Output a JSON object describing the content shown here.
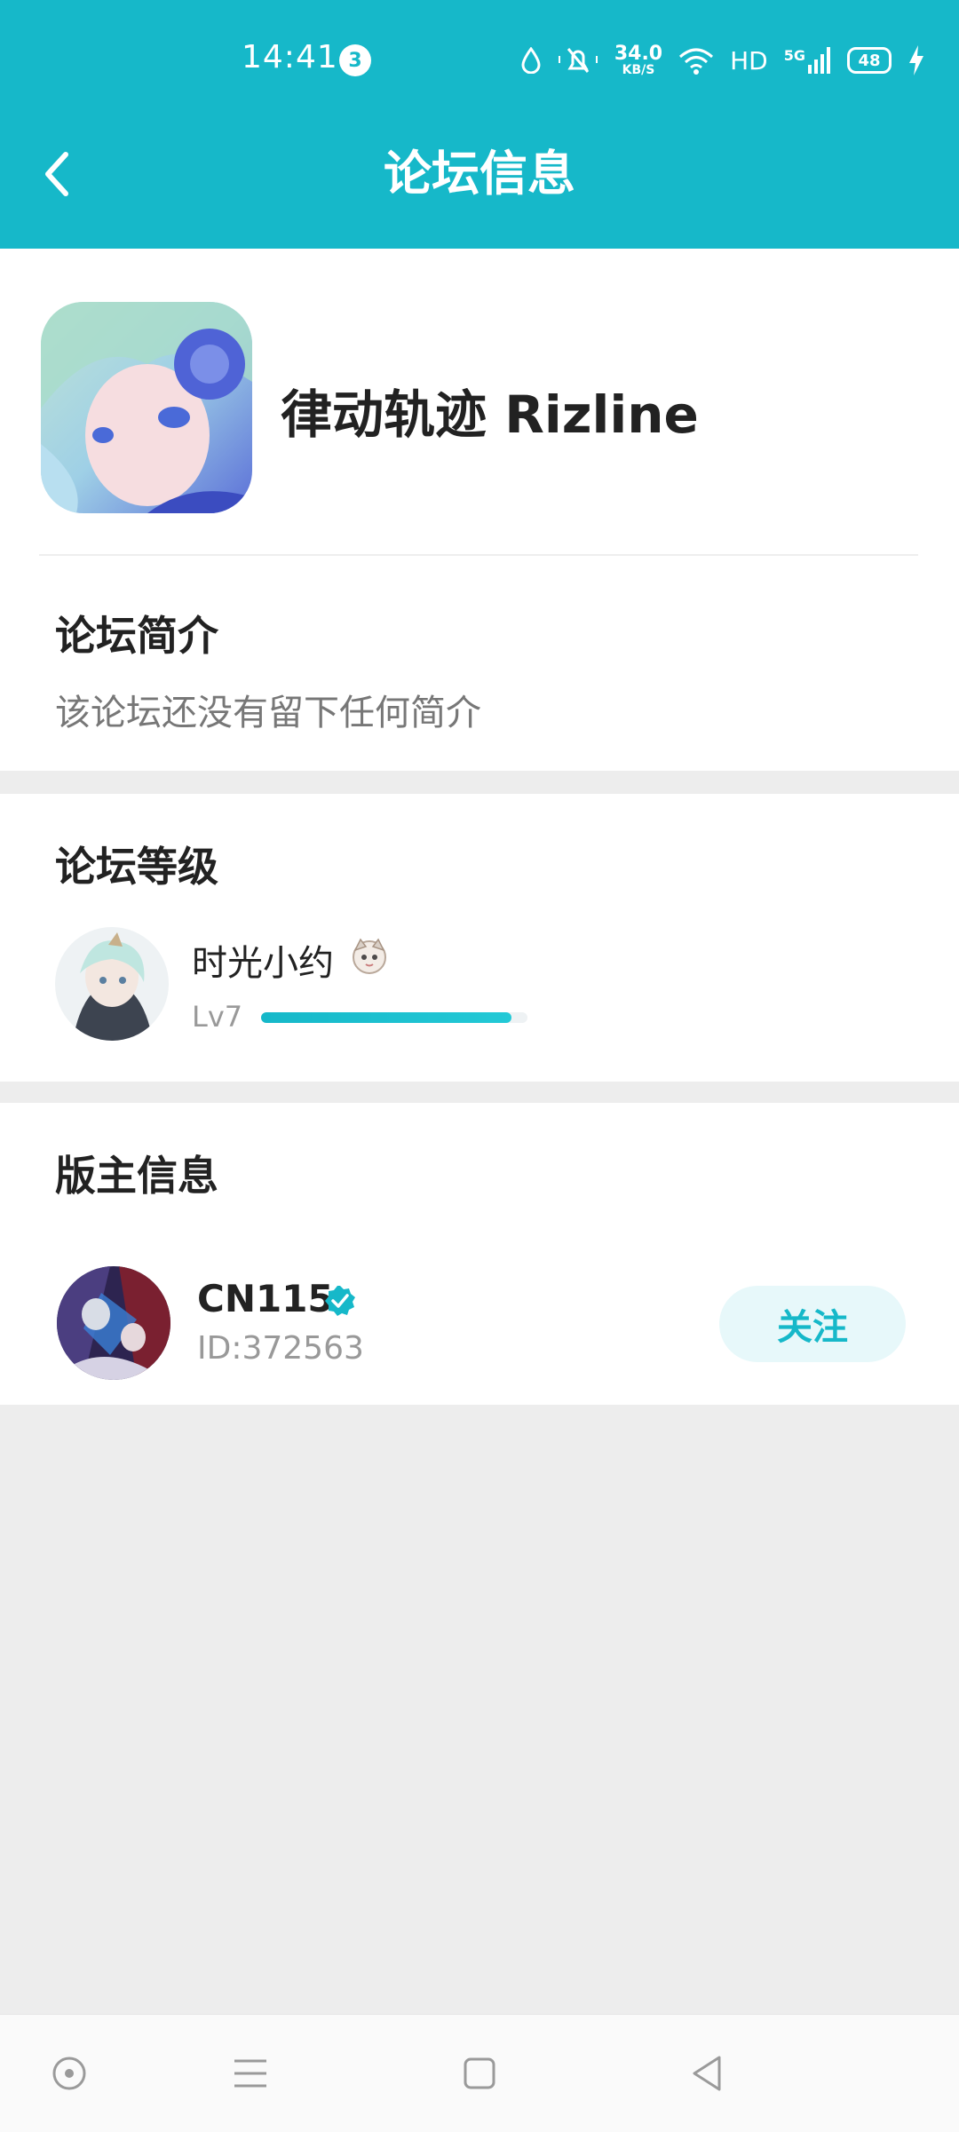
{
  "status_bar": {
    "time": "14:41",
    "notification_count": "3",
    "network_speed_value": "34.0",
    "network_speed_unit": "KB/S",
    "hd_label": "HD",
    "network_type": "5G",
    "battery": "48"
  },
  "header": {
    "title": "论坛信息"
  },
  "forum": {
    "name": "律动轨迹 Rizline"
  },
  "intro": {
    "title": "论坛简介",
    "text": "该论坛还没有留下任何简介"
  },
  "level": {
    "title": "论坛等级",
    "user_name": "时光小约",
    "level_label": "Lv7",
    "progress": 0.94
  },
  "moderator": {
    "title": "版主信息",
    "name": "CN115",
    "id": "ID:372563",
    "follow_label": "关注"
  },
  "colors": {
    "accent": "#16b8c9",
    "background": "#ededed"
  }
}
